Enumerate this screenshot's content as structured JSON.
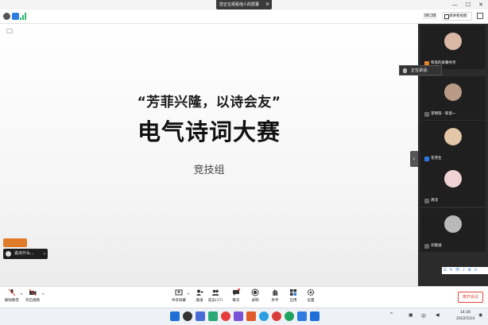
{
  "window": {
    "share_banner": "您正在观看他人的屏幕",
    "controls": [
      "—",
      "☐",
      "✕"
    ]
  },
  "status": {
    "timer": "06:38",
    "view_label": "演讲者视图"
  },
  "slide": {
    "corner_tag": "",
    "slogan": "“芳菲兴隆，以诗会友”",
    "title": "电气诗词大赛",
    "subtitle": "竞技组"
  },
  "chat": {
    "speaker_chip": "",
    "popup_text": "说点什么..."
  },
  "panel": {
    "speaking_label": "正在讲话:",
    "participants": [
      {
        "name": "和谐的屏幕共享",
        "mic": "orange",
        "color": "#d9b9a6"
      },
      {
        "name": "李明阳 · 和谐一",
        "mic": "none",
        "color": "#b89a86"
      },
      {
        "name": "花菲生",
        "mic": "blue",
        "color": "#e4c6a8"
      },
      {
        "name": "清流",
        "mic": "none",
        "color": "#f1d2d4"
      },
      {
        "name": "邓敬涵",
        "mic": "none",
        "color": "#b9b9b9"
      }
    ],
    "annot_icons": "G ✎ 中 ♪ ⚙ ✍"
  },
  "toolbar": {
    "left": [
      {
        "label": "解除静音",
        "icon": "mic-muted-icon"
      },
      {
        "label": "开启视频",
        "icon": "camera-off-icon"
      }
    ],
    "center": [
      {
        "label": "共享屏幕",
        "icon": "share-screen-icon"
      },
      {
        "label": "邀请",
        "icon": "invite-icon"
      },
      {
        "label": "成员(17)",
        "icon": "members-icon"
      },
      {
        "label": "聊天",
        "icon": "chat-icon"
      },
      {
        "label": "录制",
        "icon": "record-icon"
      },
      {
        "label": "举手",
        "icon": "raise-hand-icon"
      },
      {
        "label": "应用",
        "icon": "apps-icon"
      },
      {
        "label": "设置",
        "icon": "settings-icon"
      }
    ],
    "leave_label": "离开会议"
  },
  "taskbar": {
    "time": "14:30",
    "date": "2022/5/14",
    "colors": [
      "#1f6fd6",
      "#333333",
      "#4b6cd6",
      "#2aa876",
      "#e53d3d",
      "#7a52d6",
      "#e05a2a",
      "#2a9ee0",
      "#d93b3b",
      "#1fa45e",
      "#2f7be0",
      "#1f6fd6"
    ]
  }
}
